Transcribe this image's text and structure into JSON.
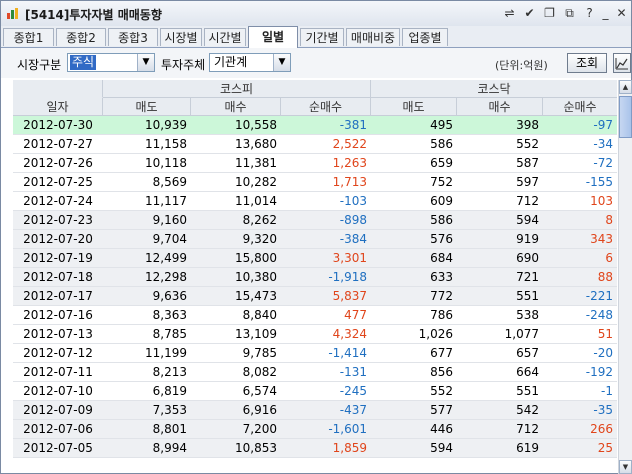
{
  "window": {
    "title": "[5414]투자자별 매매동향"
  },
  "tabs": [
    {
      "label": "종합1"
    },
    {
      "label": "종합2"
    },
    {
      "label": "종합3"
    },
    {
      "label": "시장별"
    },
    {
      "label": "시간별"
    },
    {
      "label": "일별"
    },
    {
      "label": "기간별"
    },
    {
      "label": "매매비중"
    },
    {
      "label": "업종별"
    }
  ],
  "active_tab": "일별",
  "filters": {
    "market_label": "시장구분",
    "market_value": "주식",
    "investor_label": "투자주체",
    "investor_value": "기관계",
    "unit_text": "(단위:억원)",
    "search_label": "조회"
  },
  "table": {
    "group_headers": {
      "kospi": "코스피",
      "kosdaq": "코스닥"
    },
    "columns": {
      "date": "일자",
      "sell": "매도",
      "buy": "매수",
      "net": "순매수"
    },
    "rows": [
      {
        "date": "2012-07-30",
        "k_sell": "10,939",
        "k_buy": "10,558",
        "k_net": "-381",
        "q_sell": "495",
        "q_buy": "398",
        "q_net": "-97"
      },
      {
        "date": "2012-07-27",
        "k_sell": "11,158",
        "k_buy": "13,680",
        "k_net": "2,522",
        "q_sell": "586",
        "q_buy": "552",
        "q_net": "-34"
      },
      {
        "date": "2012-07-26",
        "k_sell": "10,118",
        "k_buy": "11,381",
        "k_net": "1,263",
        "q_sell": "659",
        "q_buy": "587",
        "q_net": "-72"
      },
      {
        "date": "2012-07-25",
        "k_sell": "8,569",
        "k_buy": "10,282",
        "k_net": "1,713",
        "q_sell": "752",
        "q_buy": "597",
        "q_net": "-155"
      },
      {
        "date": "2012-07-24",
        "k_sell": "11,117",
        "k_buy": "11,014",
        "k_net": "-103",
        "q_sell": "609",
        "q_buy": "712",
        "q_net": "103"
      },
      {
        "date": "2012-07-23",
        "k_sell": "9,160",
        "k_buy": "8,262",
        "k_net": "-898",
        "q_sell": "586",
        "q_buy": "594",
        "q_net": "8"
      },
      {
        "date": "2012-07-20",
        "k_sell": "9,704",
        "k_buy": "9,320",
        "k_net": "-384",
        "q_sell": "576",
        "q_buy": "919",
        "q_net": "343"
      },
      {
        "date": "2012-07-19",
        "k_sell": "12,499",
        "k_buy": "15,800",
        "k_net": "3,301",
        "q_sell": "684",
        "q_buy": "690",
        "q_net": "6"
      },
      {
        "date": "2012-07-18",
        "k_sell": "12,298",
        "k_buy": "10,380",
        "k_net": "-1,918",
        "q_sell": "633",
        "q_buy": "721",
        "q_net": "88"
      },
      {
        "date": "2012-07-17",
        "k_sell": "9,636",
        "k_buy": "15,473",
        "k_net": "5,837",
        "q_sell": "772",
        "q_buy": "551",
        "q_net": "-221"
      },
      {
        "date": "2012-07-16",
        "k_sell": "8,363",
        "k_buy": "8,840",
        "k_net": "477",
        "q_sell": "786",
        "q_buy": "538",
        "q_net": "-248"
      },
      {
        "date": "2012-07-13",
        "k_sell": "8,785",
        "k_buy": "13,109",
        "k_net": "4,324",
        "q_sell": "1,026",
        "q_buy": "1,077",
        "q_net": "51"
      },
      {
        "date": "2012-07-12",
        "k_sell": "11,199",
        "k_buy": "9,785",
        "k_net": "-1,414",
        "q_sell": "677",
        "q_buy": "657",
        "q_net": "-20"
      },
      {
        "date": "2012-07-11",
        "k_sell": "8,213",
        "k_buy": "8,082",
        "k_net": "-131",
        "q_sell": "856",
        "q_buy": "664",
        "q_net": "-192"
      },
      {
        "date": "2012-07-10",
        "k_sell": "6,819",
        "k_buy": "6,574",
        "k_net": "-245",
        "q_sell": "552",
        "q_buy": "551",
        "q_net": "-1"
      },
      {
        "date": "2012-07-09",
        "k_sell": "7,353",
        "k_buy": "6,916",
        "k_net": "-437",
        "q_sell": "577",
        "q_buy": "542",
        "q_net": "-35"
      },
      {
        "date": "2012-07-06",
        "k_sell": "8,801",
        "k_buy": "7,200",
        "k_net": "-1,601",
        "q_sell": "446",
        "q_buy": "712",
        "q_net": "266"
      },
      {
        "date": "2012-07-05",
        "k_sell": "8,994",
        "k_buy": "10,853",
        "k_net": "1,859",
        "q_sell": "594",
        "q_buy": "619",
        "q_net": "25"
      }
    ]
  },
  "colors": {
    "positive": "#e0451b",
    "negative": "#1f6fc0",
    "selected_row": "#ccf7d9",
    "week_shade": "#eef0f3",
    "accent": "#316ac5"
  },
  "icons": [
    "app-icon",
    "link-icon",
    "check-icon",
    "copy-icon",
    "restore-icon",
    "help-icon",
    "close-icon",
    "dropdown-arrow-icon",
    "chart-icon",
    "scroll-up-icon",
    "scroll-down-icon"
  ]
}
